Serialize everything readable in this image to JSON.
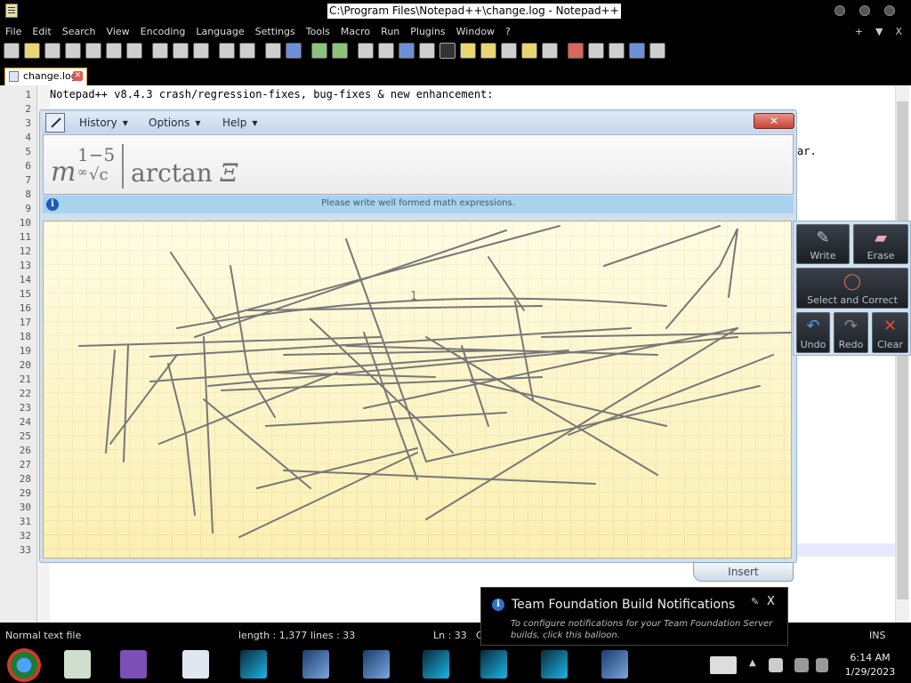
{
  "window": {
    "title": "C:\\Program Files\\Notepad++\\change.log - Notepad++"
  },
  "menubar": {
    "items": [
      "File",
      "Edit",
      "Search",
      "View",
      "Encoding",
      "Language",
      "Settings",
      "Tools",
      "Macro",
      "Run",
      "Plugins",
      "Window",
      "?"
    ],
    "right": [
      "+",
      "▼",
      "X"
    ]
  },
  "toolbar": {
    "icons": [
      "new-file-icon",
      "open-file-icon",
      "save-icon",
      "save-all-icon",
      "close-icon",
      "close-all-icon",
      "print-icon",
      "cut-icon",
      "copy-icon",
      "paste-icon",
      "undo-icon",
      "redo-icon",
      "find-icon",
      "replace-icon",
      "zoom-in-icon",
      "zoom-out-icon",
      "sync-vertical-icon",
      "sync-horizontal-icon",
      "word-wrap-icon",
      "show-all-chars-icon",
      "indent-guide-icon",
      "udl-icon",
      "doc-map-icon",
      "function-list-icon",
      "folder-workspace-icon",
      "monitoring-icon",
      "record-macro-icon",
      "stop-record-icon",
      "playback-icon",
      "run-macro-multiple-icon",
      "save-macro-icon"
    ]
  },
  "tab": {
    "label": "change.log"
  },
  "editor": {
    "line_numbers": [
      "1",
      "2",
      "3",
      "4",
      "5",
      "6",
      "7",
      "8",
      "9",
      "10",
      "11",
      "12",
      "13",
      "14",
      "15",
      "16",
      "17",
      "18",
      "19",
      "20",
      "21",
      "22",
      "23",
      "24",
      "25",
      "26",
      "27",
      "28",
      "29",
      "30",
      "31",
      "32",
      "33"
    ],
    "line1": "Notepad++ v8.4.3 crash/regression-fixes, bug-fixes & new enhancement:",
    "line5_fragment": "ar."
  },
  "math_panel": {
    "menus": [
      "History",
      "Options",
      "Help"
    ],
    "close": "✕",
    "formula": {
      "base": "m",
      "sup": "1−5",
      "sub_inf": "∞",
      "radical": "√c",
      "rest": "arctan ",
      "xi": "Ξ"
    },
    "info": "Please write well formed math expressions.",
    "insert": "Insert",
    "stray_digit": "1"
  },
  "palette": {
    "write": "Write",
    "erase": "Erase",
    "select": "Select and Correct",
    "undo": "Undo",
    "redo": "Redo",
    "clear": "Clear"
  },
  "statusbar": {
    "file_type": "Normal text file",
    "length": "length : 1,377",
    "lines": "lines : 33",
    "ln": "Ln : 33",
    "col_fragment": "C",
    "ins": "INS"
  },
  "balloon": {
    "title": "Team Foundation Build Notifications",
    "text": "To configure notifications for your Team Foundation Server builds, click this balloon.",
    "close": "X"
  },
  "clock": {
    "time": "6:14 AM",
    "date": "1/29/2023"
  }
}
